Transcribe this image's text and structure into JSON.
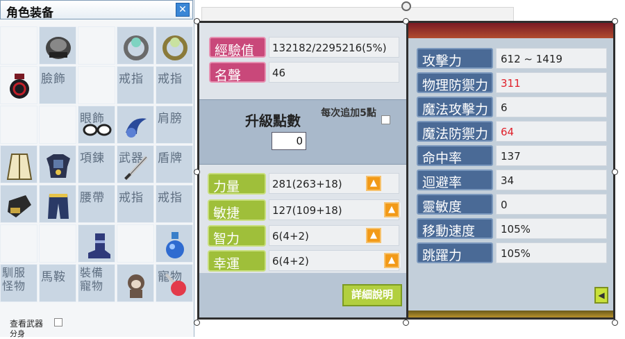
{
  "equipment": {
    "title": "角色装备",
    "close_icon": "close-icon",
    "slot_labels": {
      "face": "臉飾",
      "ring1": "戒指",
      "ring2": "戒指",
      "eye": "眼飾",
      "shoulder": "肩膀",
      "neck": "項鍊",
      "weapon": "武器",
      "shield": "盾牌",
      "belt": "腰帶",
      "ring3": "戒指",
      "ring4": "戒指",
      "pet_equip": "寵物",
      "tame_monster": "馴服\n怪物",
      "saddle": "馬鞍",
      "pet_gear": "裝備\n寵物"
    },
    "weapon_toggle": "查看武器",
    "weapon_toggle_sub": "分身"
  },
  "stats": {
    "exp_label": "經驗值",
    "exp_value": "132182/2295216(5%)",
    "fame_label": "名聲",
    "fame_value": "46",
    "ap_title": "升級點數",
    "ap_value": "0",
    "auto_add_label": "每次追加5點",
    "str_label": "力量",
    "str_value": "281(263+18)",
    "dex_label": "敏捷",
    "dex_value": "127(109+18)",
    "int_label": "智力",
    "int_value": "6(4+2)",
    "luk_label": "幸運",
    "luk_value": "6(4+2)",
    "plus_icon": "arrow-up-icon",
    "detail_button": "詳細說明"
  },
  "detail": {
    "rows": [
      {
        "label": "攻擊力",
        "value": "612 ~ 1419"
      },
      {
        "label": "物理防禦力",
        "value": "311"
      },
      {
        "label": "魔法攻擊力",
        "value": "6"
      },
      {
        "label": "魔法防禦力",
        "value": "64"
      },
      {
        "label": "命中率",
        "value": "137"
      },
      {
        "label": "迴避率",
        "value": "34"
      },
      {
        "label": "靈敏度",
        "value": "0"
      },
      {
        "label": "移動速度",
        "value": "105%"
      },
      {
        "label": "跳躍力",
        "value": "105%"
      }
    ],
    "back_icon": "arrow-left-icon"
  },
  "colors": {
    "accent_red": "#e0202a",
    "label_blue": "#4a6a96",
    "label_green": "#9fbf3a",
    "label_pink": "#c9487a"
  }
}
